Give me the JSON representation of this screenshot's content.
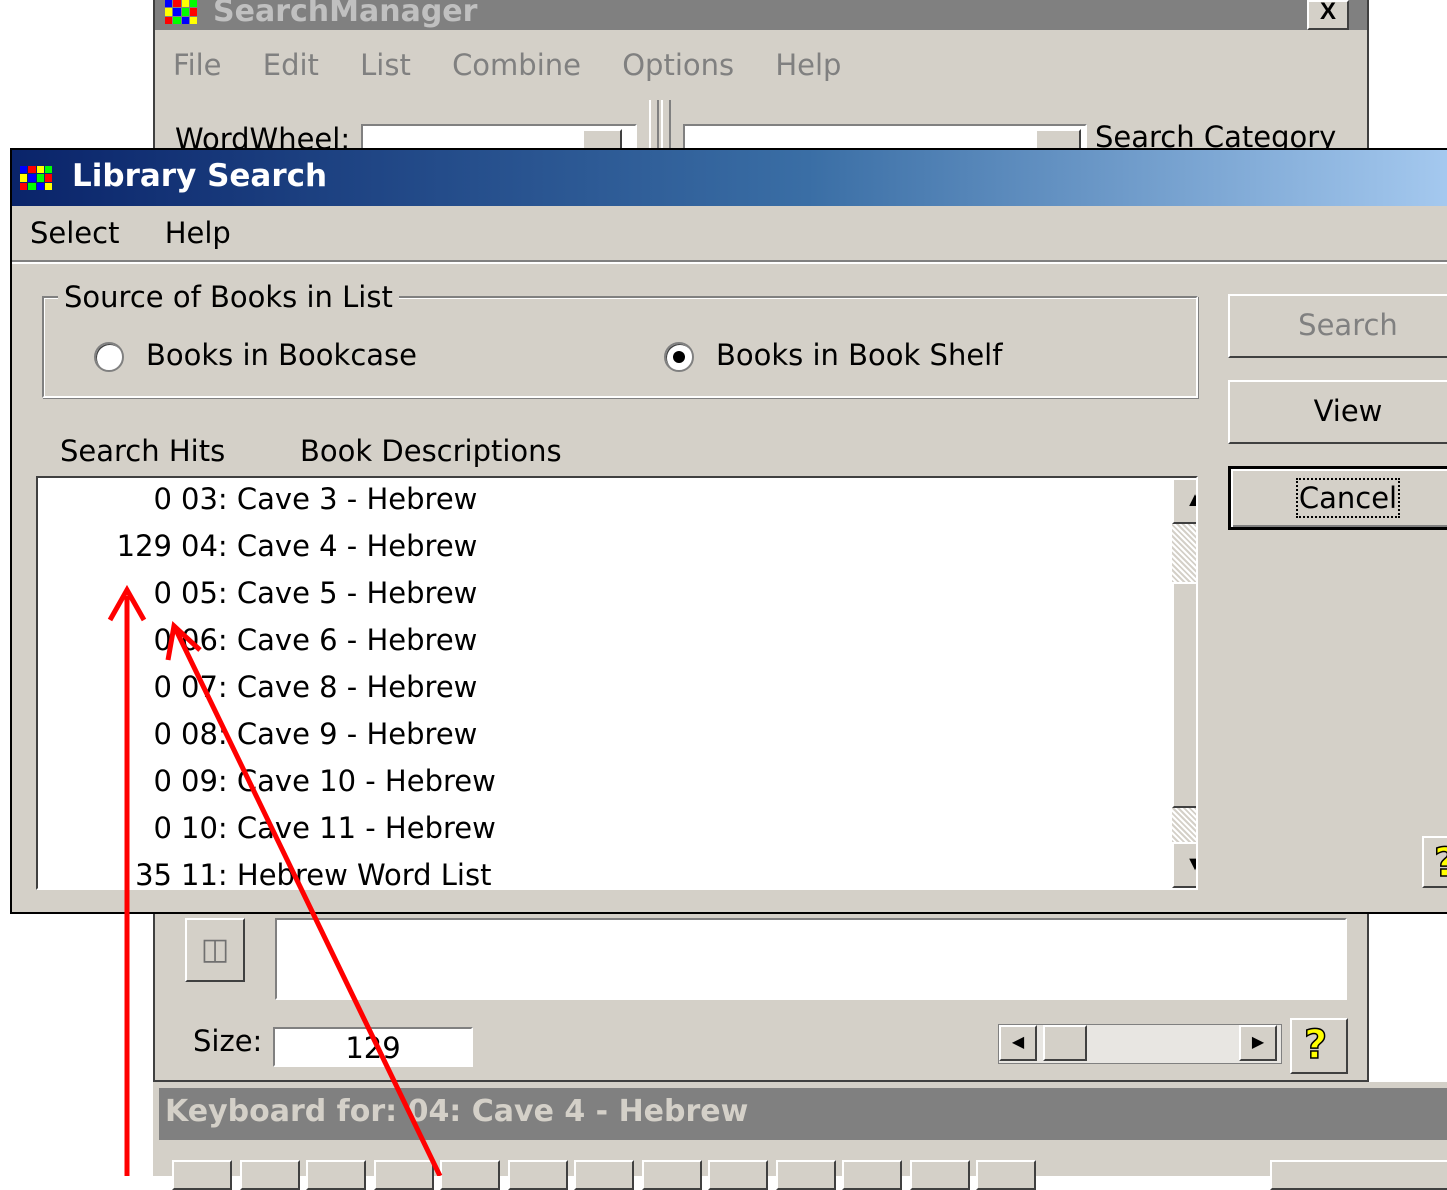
{
  "search_manager": {
    "title": "SearchManager",
    "close_label": "X",
    "menu": [
      "File",
      "Edit",
      "List",
      "Combine",
      "Options",
      "Help"
    ],
    "wordwheel_label": "WordWheel:",
    "search_category_label": "Search Category",
    "size_label": "Size:",
    "size_value": "129",
    "help_label": "?"
  },
  "keyboard": {
    "title": "Keyboard for: 04: Cave 4 - Hebrew"
  },
  "library_search": {
    "title": "Library Search",
    "menu": [
      "Select",
      "Help"
    ],
    "source_group_label": "Source of Books in List",
    "radio_bookcase": "Books in Bookcase",
    "radio_bookshelf": "Books in Book Shelf",
    "selected_source": "Books in Book Shelf",
    "header_hits": "Search Hits",
    "header_desc": "Book Descriptions",
    "rows": [
      {
        "hits": "0",
        "desc": "03: Cave 3 - Hebrew"
      },
      {
        "hits": "129",
        "desc": "04: Cave 4 - Hebrew"
      },
      {
        "hits": "0",
        "desc": "05: Cave 5 - Hebrew"
      },
      {
        "hits": "0",
        "desc": "06: Cave 6 - Hebrew"
      },
      {
        "hits": "0",
        "desc": "07: Cave 8 - Hebrew"
      },
      {
        "hits": "0",
        "desc": "08: Cave 9 - Hebrew"
      },
      {
        "hits": "0",
        "desc": "09: Cave 10 - Hebrew"
      },
      {
        "hits": "0",
        "desc": "10: Cave 11 - Hebrew"
      },
      {
        "hits": "35",
        "desc": "11: Hebrew Word List"
      }
    ],
    "buttons": {
      "search": "Search",
      "view": "View",
      "cancel": "Cancel"
    },
    "help_label": "?"
  },
  "colors": {
    "title_active_start": "#0a246a",
    "title_active_end": "#a6caf0",
    "title_inactive": "#808080",
    "face": "#d4d0c8",
    "annotation_arrow": "#ff0000"
  }
}
